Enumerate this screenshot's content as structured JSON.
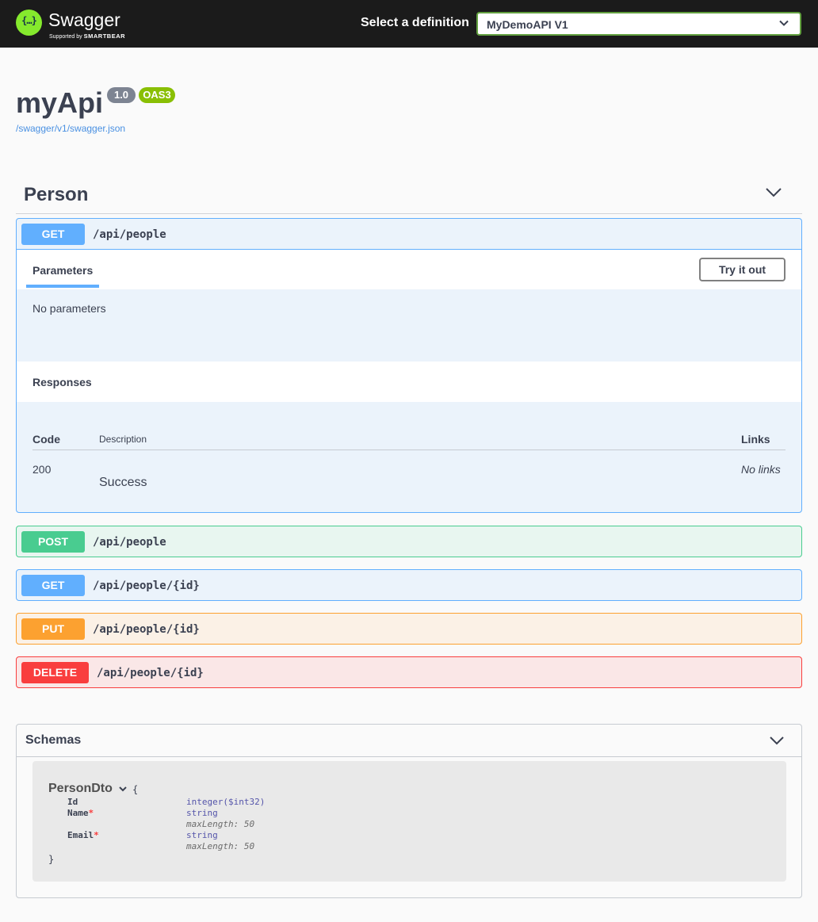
{
  "topbar": {
    "logo_glyph": "{…}",
    "logo_text": "Swagger",
    "logo_sub_prefix": "Supported by",
    "logo_sub_brand": "SMARTBEAR",
    "definition_label": "Select a definition",
    "definition_value": "MyDemoAPI V1"
  },
  "info": {
    "title": "myApi",
    "version": "1.0",
    "oas": "OAS3",
    "spec_link": "/swagger/v1/swagger.json"
  },
  "tag": {
    "name": "Person"
  },
  "operations": [
    {
      "method": "GET",
      "path": "/api/people",
      "expanded": true
    },
    {
      "method": "POST",
      "path": "/api/people"
    },
    {
      "method": "GET",
      "path": "/api/people/{id}"
    },
    {
      "method": "PUT",
      "path": "/api/people/{id}"
    },
    {
      "method": "DELETE",
      "path": "/api/people/{id}"
    }
  ],
  "expanded_op": {
    "parameters_tab": "Parameters",
    "try_button": "Try it out",
    "no_params": "No parameters",
    "responses_title": "Responses",
    "columns": {
      "code": "Code",
      "description": "Description",
      "links": "Links"
    },
    "rows": [
      {
        "code": "200",
        "description": "Success",
        "links": "No links"
      }
    ]
  },
  "schemas": {
    "title": "Schemas",
    "model": {
      "name": "PersonDto",
      "open_brace": "{",
      "close_brace": "}",
      "required_mark": "*",
      "props": [
        {
          "name": "Id",
          "type": "integer($int32)",
          "meta": ""
        },
        {
          "name": "Name",
          "type": "string",
          "meta": "maxLength: 50"
        },
        {
          "name": "Email",
          "type": "string",
          "meta": "maxLength: 50"
        }
      ]
    }
  },
  "colors": {
    "get": "#61affe",
    "post": "#49cc90",
    "put": "#fca130",
    "delete": "#f93e3e",
    "accent_green": "#85ea2d"
  }
}
